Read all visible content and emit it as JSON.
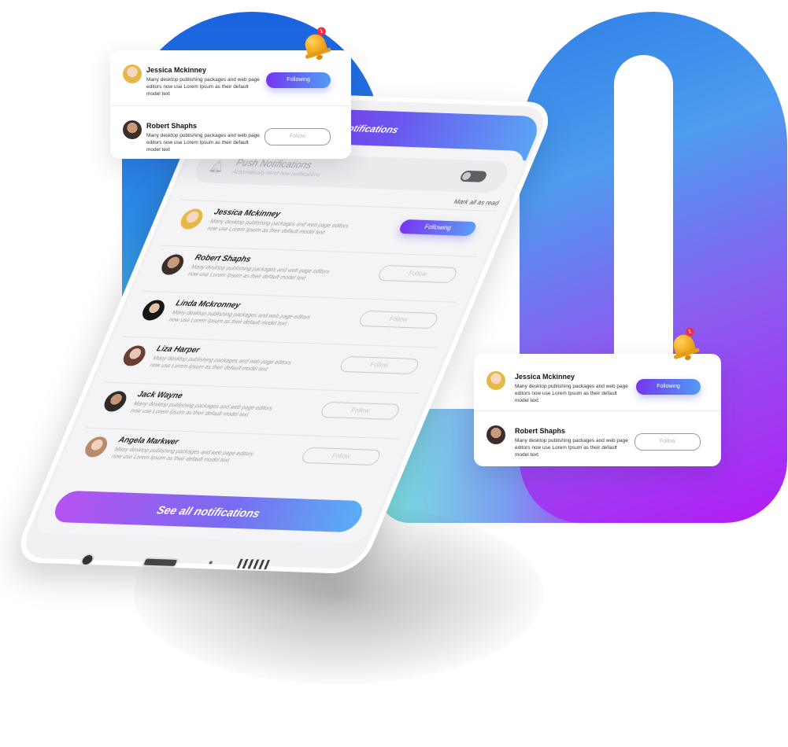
{
  "phone": {
    "back_icon": "chevron-left-icon",
    "back_glyph": "‹",
    "title": "Notifications",
    "push": {
      "title": "Push Notifications",
      "subtitle": "Automatically send new notifications",
      "enabled": false
    },
    "mark_all_read": "Mark all as read",
    "notifications": [
      {
        "name": "Jessica Mckinney",
        "desc": "Many desktop publishing packages and web page editors now use Lorem Ipsum as their default model text",
        "button": "Following",
        "state": "following"
      },
      {
        "name": "Robert Shaphs",
        "desc": "Many desktop publishing packages and web page editors now use Lorem Ipsum as their default model text",
        "button": "Follow",
        "state": "follow"
      },
      {
        "name": "Linda Mckronney",
        "desc": "Many desktop publishing packages and web page editors now use Lorem Ipsum as their default model text",
        "button": "Follow",
        "state": "follow"
      },
      {
        "name": "Liza Harper",
        "desc": "Many desktop publishing packages and web page editors now use Lorem Ipsum as their default model text",
        "button": "Follow",
        "state": "follow"
      },
      {
        "name": "Jack Wayne",
        "desc": "Many desktop publishing packages and web page editors now use Lorem Ipsum as their default model text",
        "button": "Follow",
        "state": "follow"
      },
      {
        "name": "Angela Markwer",
        "desc": "Many desktop publishing packages and web page editors now use Lorem Ipsum as their default model text",
        "button": "Follow",
        "state": "follow"
      }
    ],
    "see_all": "See all notifications"
  },
  "card_left": {
    "bell_badge": "1",
    "rows": [
      {
        "name": "Jessica Mckinney",
        "desc": "Many desktop publishing packages and web page editors now use Lorem Ipsum as their default model text",
        "button": "Following",
        "state": "following"
      },
      {
        "name": "Robert Shaphs",
        "desc": "Many desktop publishing packages and web page editors now use Lorem Ipsum as their default model text",
        "button": "Follow",
        "state": "follow"
      }
    ]
  },
  "card_right": {
    "bell_badge": "1",
    "rows": [
      {
        "name": "Jessica Mckinney",
        "desc": "Many desktop publishing packages and web page editors now use Lorem Ipsum as their default model text",
        "button": "Following",
        "state": "following"
      },
      {
        "name": "Robert Shaphs",
        "desc": "Many desktop publishing packages and web page editors now use Lorem Ipsum as their default model text",
        "button": "Follow",
        "state": "follow"
      }
    ]
  },
  "colors": {
    "gradient_blue": "#1a62e0",
    "gradient_purple": "#b21cf4",
    "gradient_teal": "#7de6df",
    "following_button": "#7436f0",
    "bell": "#f2a51e",
    "badge": "#ec2e4a"
  }
}
